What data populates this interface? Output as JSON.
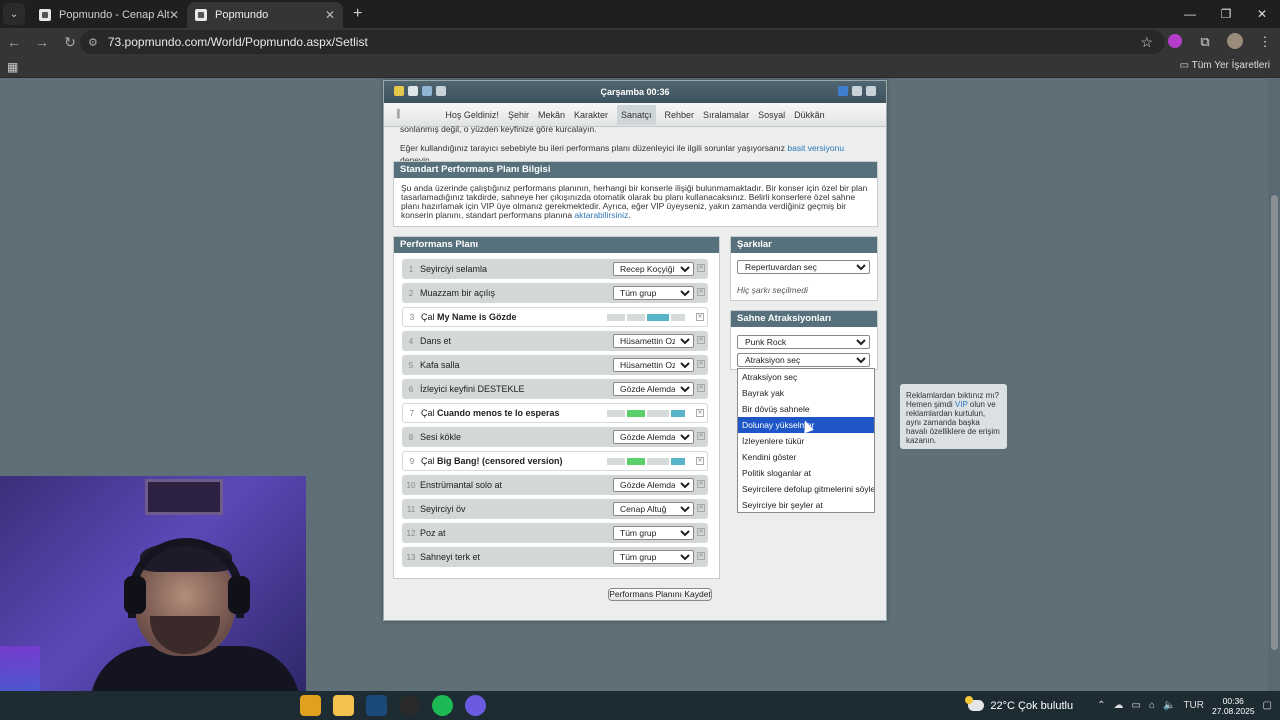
{
  "browser": {
    "tabs": [
      {
        "title": "Popmundo - Cenap Altuğ"
      },
      {
        "title": "Popmundo"
      }
    ],
    "url": "73.popmundo.com/World/Popmundo.aspx/Setlist",
    "bookmarks_label": "Tüm Yer İşaretleri"
  },
  "game": {
    "clock": "Çarşamba 00:36",
    "menu": [
      "Hoş Geldiniz!",
      "Şehir",
      "Mekân",
      "Karakter",
      "Sanatçı",
      "Rehber",
      "Sıralamalar",
      "Sosyal",
      "Dükkân"
    ],
    "notice_line1": "sonlanmış değil, o yüzden keyfinize göre kurcalayın.",
    "notice_line2_pre": "Eğer kullandığınız tarayıcı sebebiyle bu ileri performans planı düzenleyici ile ilgili sorunlar yaşıyorsanız ",
    "notice_link": "basit versiyonu",
    "notice_line2_post": " deneyin.",
    "std_panel": {
      "title": "Standart Performans Planı Bilgisi",
      "body_pre": "Şu anda üzerinde çalıştığınız performans planının, herhangi bir konserle ilişiği bulunmamaktadır. Bir konser için özel bir plan tasarlamadığınız takdirde, sahneye her çıkışınızda otomatik olarak bu planı kullanacaksınız. Belirli konserlere özel sahne planı hazırlamak için VIP üye olmanız gerekmektedir. Ayrıca, eğer VIP üyeyseniz, yakın zamanda verdiğiniz geçmiş bir konserin planını, standart performans planına ",
      "body_link": "aktarabilirsiniz",
      "body_post": "."
    },
    "plan_panel": {
      "title": "Performans Planı",
      "rows": [
        {
          "num": "1",
          "pre": "Seyirciyi selamla",
          "bold": "",
          "who": "Recep Koçyiğit"
        },
        {
          "num": "2",
          "pre": "Muazzam bir açılış",
          "bold": "",
          "who": "Tüm grup"
        },
        {
          "num": "3",
          "pre": "Çal ",
          "bold": "My Name is Gözde",
          "who": ""
        },
        {
          "num": "4",
          "pre": "Dans et",
          "bold": "",
          "who": "Hüsamettin Ozan"
        },
        {
          "num": "5",
          "pre": "Kafa salla",
          "bold": "",
          "who": "Hüsamettin Ozan"
        },
        {
          "num": "6",
          "pre": "İzleyici keyfini DESTEKLE",
          "bold": "",
          "who": "Gözde Alemdar"
        },
        {
          "num": "7",
          "pre": "Çal ",
          "bold": "Cuando menos te lo esperas",
          "who": ""
        },
        {
          "num": "8",
          "pre": "Sesi kökle",
          "bold": "",
          "who": "Gözde Alemdar"
        },
        {
          "num": "9",
          "pre": "Çal ",
          "bold": "Big Bang! (censored version)",
          "who": ""
        },
        {
          "num": "10",
          "pre": "Enstrümantal solo at",
          "bold": "",
          "who": "Gözde Alemdar"
        },
        {
          "num": "11",
          "pre": "Seyirciyi öv",
          "bold": "",
          "who": "Cenap Altuğ"
        },
        {
          "num": "12",
          "pre": "Poz at",
          "bold": "",
          "who": "Tüm grup"
        },
        {
          "num": "13",
          "pre": "Sahneyi terk et",
          "bold": "",
          "who": "Tüm grup"
        }
      ],
      "save_label": "Performans Planını Kaydet"
    },
    "songs_panel": {
      "title": "Şarkılar",
      "select_value": "Repertuvardan seç",
      "empty_text": "Hiç şarkı seçilmedi"
    },
    "attractions_panel": {
      "title": "Sahne Atraksiyonları",
      "genre_value": "Punk Rock",
      "attraction_value": "Atraksiyon seç",
      "options": [
        "Atraksiyon seç",
        "Bayrak yak",
        "Bir dövüş sahnele",
        "Dolunay yükselmer",
        "İzleyenlere tükür",
        "Kendini göster",
        "Politik sloganlar at",
        "Seyircilere defolup gitmelerini söyle",
        "Seyirciye bir şeyler at"
      ],
      "highlighted_index": 3
    },
    "vip_box": {
      "pre": "Reklamlardan bıktınız mı? Hemen şimdi ",
      "link": "VIP",
      "post": " olun ve reklamlardan kurtulun, aynı zamanda başka havalı özelliklere de erişim kazanın."
    }
  },
  "taskbar": {
    "weather": "22°C  Çok bulutlu",
    "lang": "TUR",
    "time": "00:36",
    "date": "27.08.2025"
  }
}
